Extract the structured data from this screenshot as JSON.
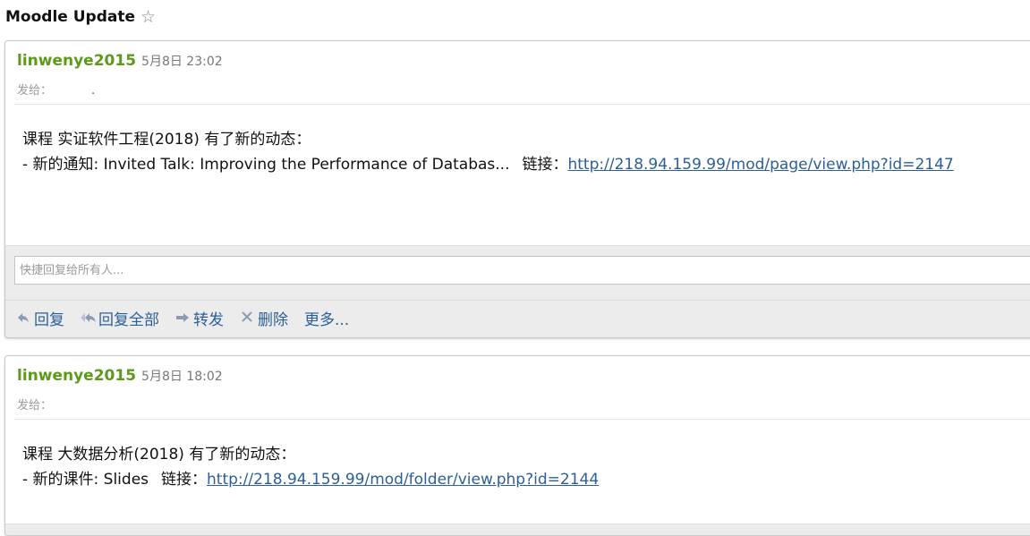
{
  "thread": {
    "title": "Moodle Update",
    "star_icon": "☆"
  },
  "messages": [
    {
      "sender": "linwenye2015",
      "date": "5月8日 23:02",
      "to_label": "发给：",
      "to_value": ".",
      "body_line1": "课程 实证软件工程(2018) 有了新的动态：",
      "body_line2_prefix": "- 新的通知: Invited Talk: Improving the Performance of Databas...",
      "link_label": "链接：",
      "link": "http://218.94.159.99/mod/page/view.php?id=2147"
    },
    {
      "sender": "linwenye2015",
      "date": "5月8日 18:02",
      "to_label": "发给：",
      "to_value": "",
      "body_line1": "课程 大数据分析(2018) 有了新的动态：",
      "body_line2_prefix": "- 新的课件: Slides",
      "link_label": "链接：",
      "link": "http://218.94.159.99/mod/folder/view.php?id=2144"
    }
  ],
  "quick_reply": {
    "placeholder": "快捷回复给所有人..."
  },
  "actions": {
    "reply": "回复",
    "reply_all": "回复全部",
    "forward": "转发",
    "delete": "删除",
    "more": "更多..."
  },
  "icons": {
    "reply": "reply-icon",
    "reply_all": "reply-all-icon",
    "forward": "forward-icon",
    "delete": "delete-icon",
    "star": "star-icon"
  },
  "colors": {
    "sender": "#5c9a1a",
    "link": "#2b5f99",
    "action_icon": "#8d9bb0"
  }
}
